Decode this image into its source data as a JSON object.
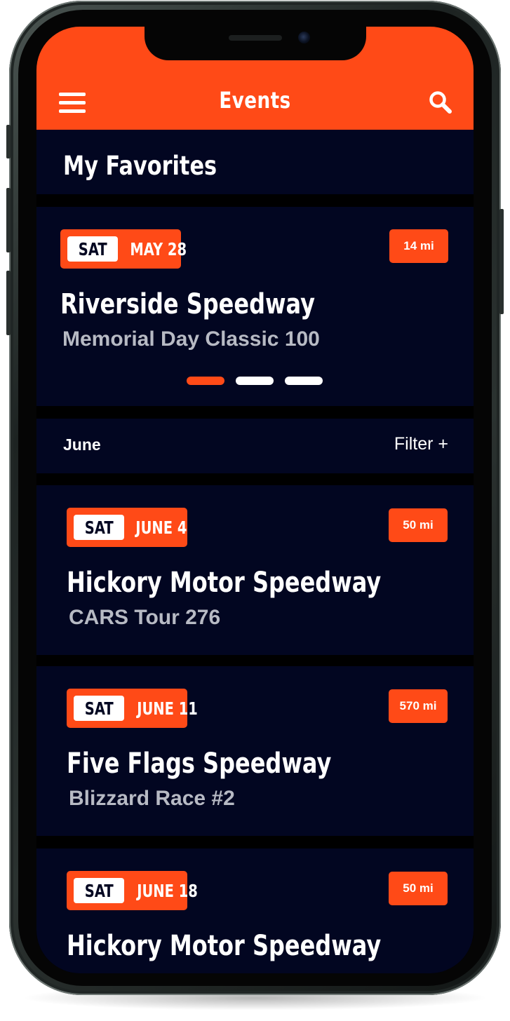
{
  "header": {
    "title": "Events"
  },
  "favorites": {
    "title": "My Favorites",
    "card": {
      "day": "SAT",
      "date": "MAY 28",
      "distance": "14 mi",
      "venue": "Riverside Speedway",
      "event": "Memorial Day Classic 100"
    },
    "carousel": {
      "count": 3,
      "active_index": 0
    }
  },
  "events_section": {
    "month": "June",
    "filter_label": "Filter +"
  },
  "events": [
    {
      "day": "SAT",
      "date": "JUNE 4",
      "distance": "50 mi",
      "venue": "Hickory Motor Speedway",
      "event": "CARS Tour 276"
    },
    {
      "day": "SAT",
      "date": "JUNE 11",
      "distance": "570 mi",
      "venue": "Five Flags Speedway",
      "event": "Blizzard Race #2"
    },
    {
      "day": "SAT",
      "date": "JUNE 18",
      "distance": "50 mi",
      "venue": "Hickory Motor Speedway",
      "event": ""
    }
  ],
  "colors": {
    "accent": "#ff4a17",
    "background": "#020621",
    "subtitle": "#b7bac4",
    "dot_inactive": "#ffffff"
  },
  "icons": {
    "menu": "hamburger-menu-icon",
    "search": "search-icon"
  }
}
